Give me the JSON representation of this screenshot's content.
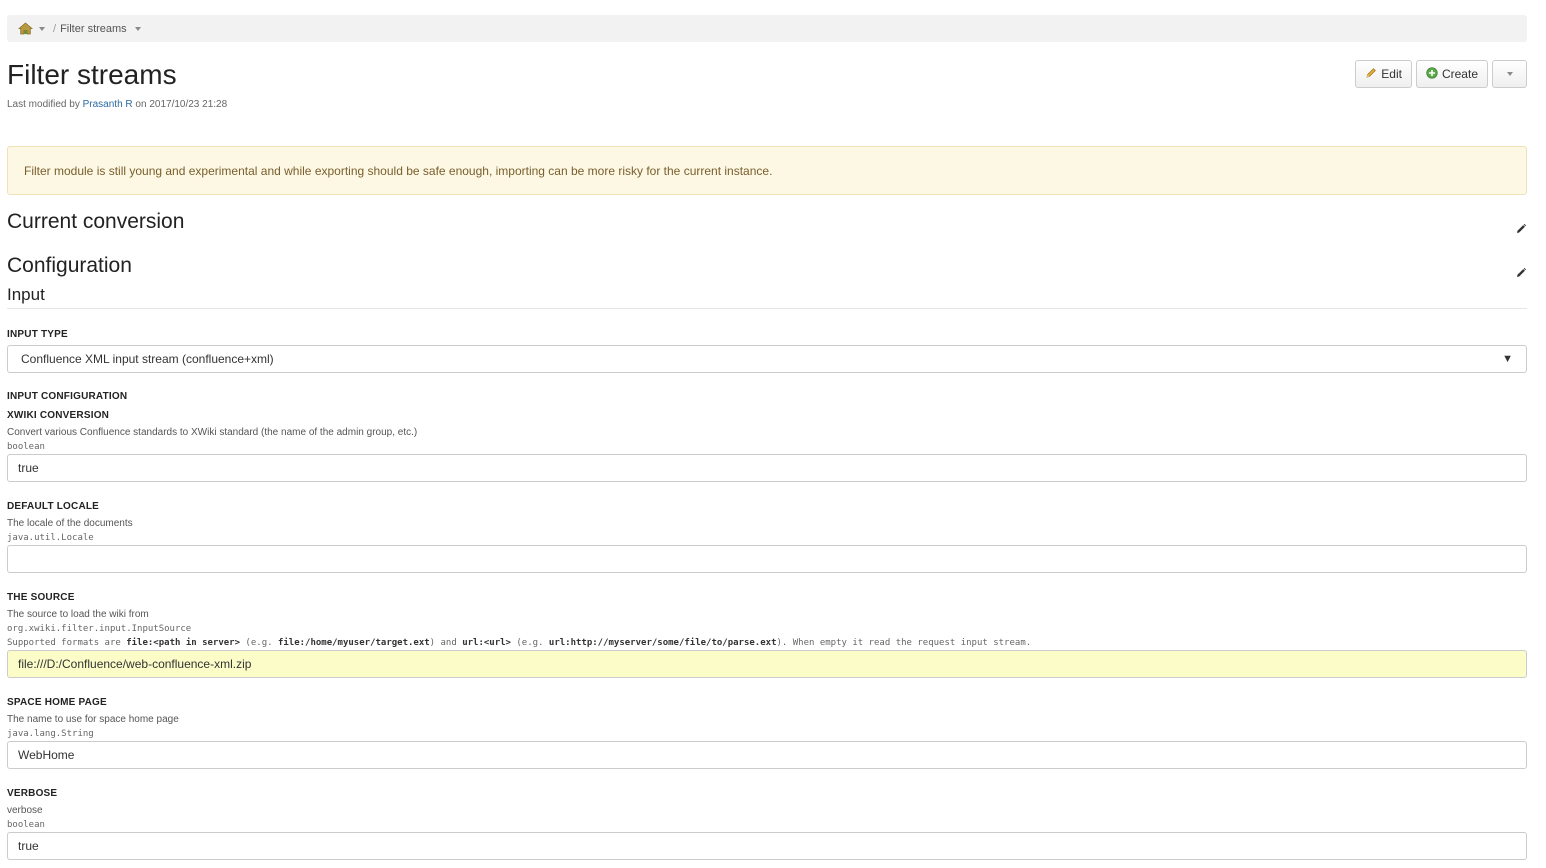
{
  "breadcrumb": {
    "home_icon": "home-icon",
    "current": "Filter streams"
  },
  "page": {
    "title": "Filter streams",
    "meta_prefix": "Last modified by",
    "meta_author": "Prasanth R",
    "meta_suffix": "on 2017/10/23 21:28"
  },
  "actions": {
    "edit_label": "Edit",
    "create_label": "Create"
  },
  "warning": "Filter module is still young and experimental and while exporting should be safe enough, importing can be more risky for the current instance.",
  "sections": {
    "current_conversion": "Current conversion",
    "configuration": "Configuration",
    "input": "Input"
  },
  "input_type": {
    "label": "INPUT TYPE",
    "selected": "Confluence XML input stream (confluence+xml)"
  },
  "input_configuration": {
    "label": "INPUT CONFIGURATION"
  },
  "fields": {
    "xwiki_conversion": {
      "label": "XWIKI CONVERSION",
      "description": "Convert various Confluence standards to XWiki standard (the name of the admin group, etc.)",
      "type": "boolean",
      "value": "true"
    },
    "default_locale": {
      "label": "DEFAULT LOCALE",
      "description": "The locale of the documents",
      "type": "java.util.Locale",
      "value": ""
    },
    "the_source": {
      "label": "THE SOURCE",
      "description": "The source to load the wiki from",
      "type": "org.xwiki.filter.input.InputSource",
      "formats_p1": "Supported formats are ",
      "formats_b1": "file:<path in server>",
      "formats_p2": " (e.g. ",
      "formats_b2": "file:/home/myuser/target.ext",
      "formats_p3": ") and ",
      "formats_b3": "url:<url>",
      "formats_p4": " (e.g. ",
      "formats_b4": "url:http://myserver/some/file/to/parse.ext",
      "formats_p5": "). When empty it read the request input stream.",
      "value": "file:///D:/Confluence/web-confluence-xml.zip"
    },
    "space_home_page": {
      "label": "SPACE HOME PAGE",
      "description": "The name to use for space home page",
      "type": "java.lang.String",
      "value": "WebHome"
    },
    "verbose": {
      "label": "VERBOSE",
      "description": "verbose",
      "type": "boolean",
      "value": "true"
    }
  }
}
